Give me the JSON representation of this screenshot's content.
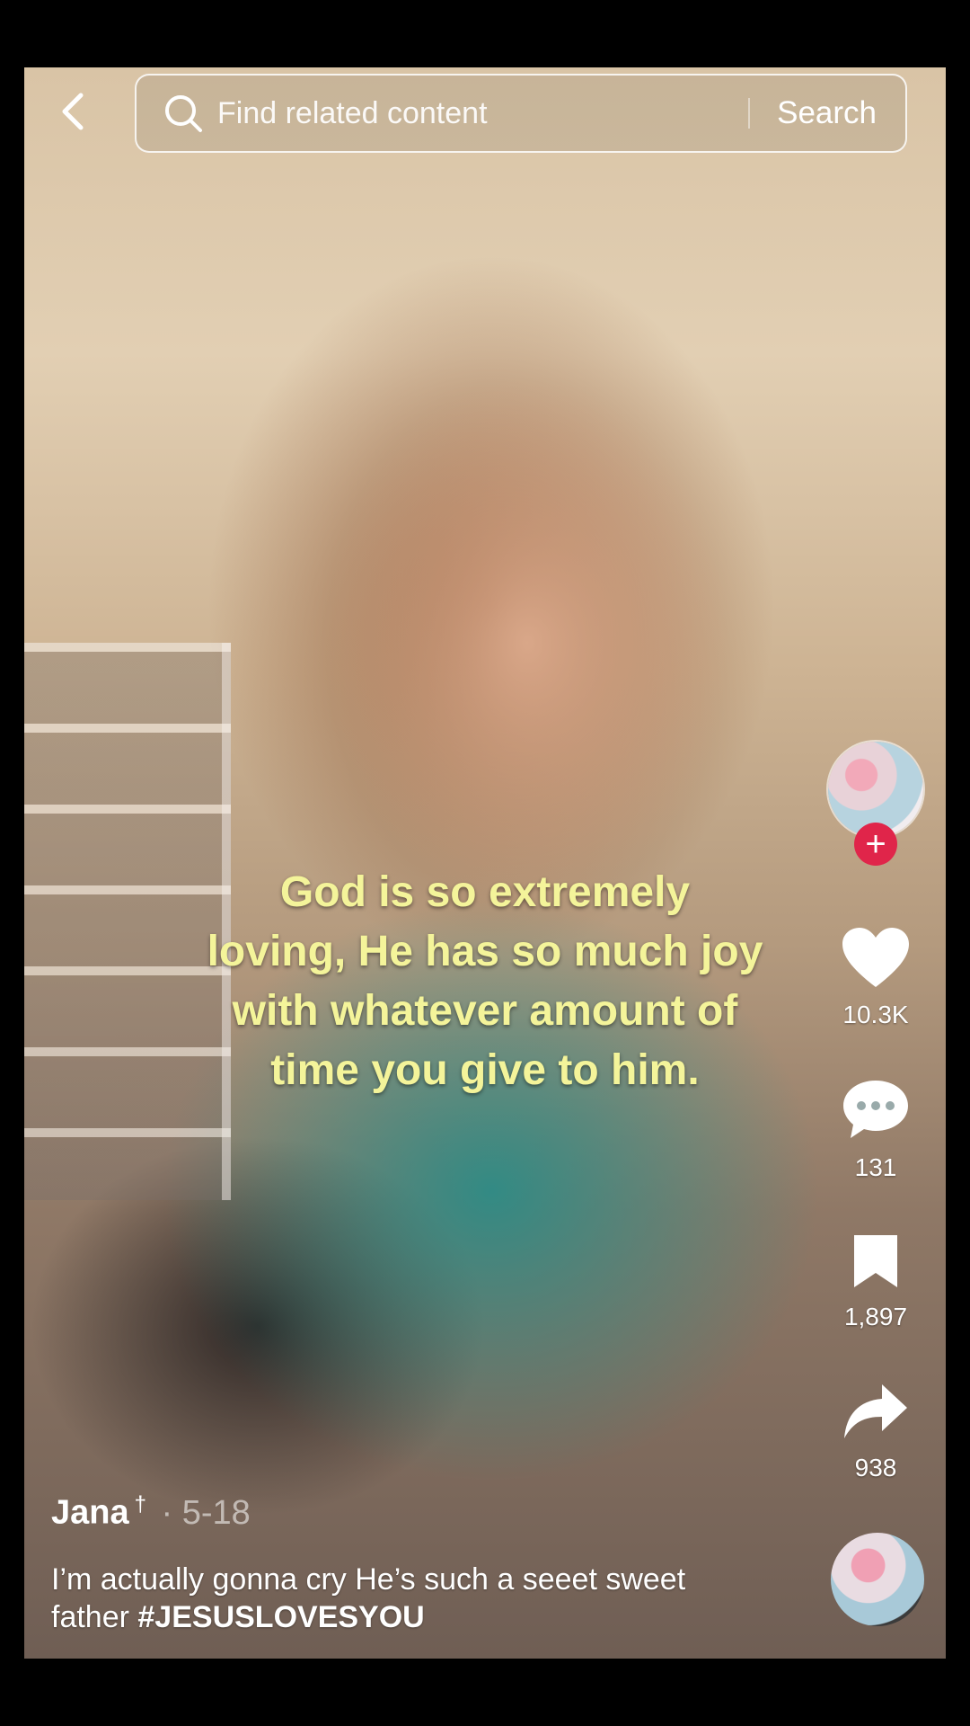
{
  "search": {
    "placeholder": "Find related content",
    "button_label": "Search"
  },
  "video": {
    "caption_lines": [
      "God is so extremely",
      "loving, He has so much joy",
      "with whatever amount of",
      "time you give to him."
    ]
  },
  "actions": {
    "likes": "10.3K",
    "comments": "131",
    "saves": "1,897",
    "shares": "938",
    "follow_symbol": "+"
  },
  "post": {
    "username": "Jana",
    "badge": "†",
    "date": "· 5-18",
    "description": "I’m actually gonna cry He’s such a seeet sweet father ",
    "hashtag": "#JESUSLOVESYOU"
  },
  "icons": {
    "back": "chevron-left",
    "search": "magnifier",
    "like": "heart",
    "comment": "speech-bubble-dots",
    "save": "bookmark",
    "share": "curved-arrow"
  },
  "colors": {
    "caption": "#f4f49a",
    "follow": "#e0254a"
  }
}
